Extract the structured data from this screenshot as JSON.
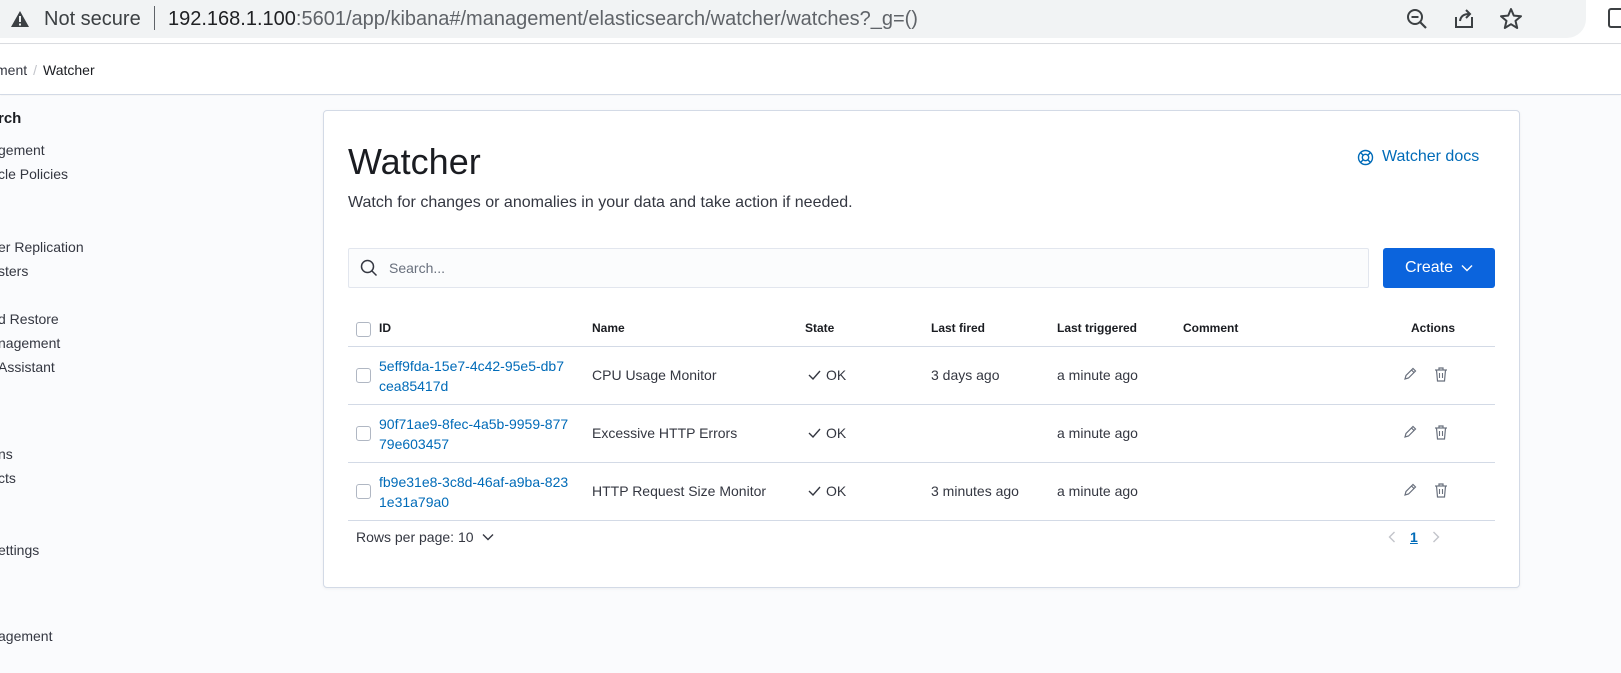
{
  "browser": {
    "security_label": "Not secure",
    "url_host": "192.168.1.100",
    "url_rest": ":5601/app/kibana#/management/elasticsearch/watcher/watches?_g=()"
  },
  "breadcrumb": {
    "parent": "ment",
    "current": "Watcher"
  },
  "sidebar": {
    "section_title": "rch",
    "items": [
      "gement",
      "cle Policies",
      "er Replication",
      "sters",
      "d Restore",
      "nagement",
      " Assistant",
      "ns",
      "cts",
      "ettings",
      "agement"
    ]
  },
  "header": {
    "title": "Watcher",
    "subtitle": "Watch for changes or anomalies in your data and take action if needed.",
    "docs_link": "Watcher docs"
  },
  "search": {
    "placeholder": "Search..."
  },
  "create_button": "Create",
  "table": {
    "columns": {
      "id": "ID",
      "name": "Name",
      "state": "State",
      "last_fired": "Last fired",
      "last_triggered": "Last triggered",
      "comment": "Comment",
      "actions": "Actions"
    },
    "rows": [
      {
        "id": "5eff9fda-15e7-4c42-95e5-db7cea85417d",
        "name": "CPU Usage Monitor",
        "state": "OK",
        "last_fired": "3 days ago",
        "last_triggered": "a minute ago",
        "comment": ""
      },
      {
        "id": "90f71ae9-8fec-4a5b-9959-87779e603457",
        "name": "Excessive HTTP Errors",
        "state": "OK",
        "last_fired": "",
        "last_triggered": "a minute ago",
        "comment": ""
      },
      {
        "id": "fb9e31e8-3c8d-46af-a9ba-8231e31a79a0",
        "name": "HTTP Request Size Monitor",
        "state": "OK",
        "last_fired": "3 minutes ago",
        "last_triggered": "a minute ago",
        "comment": ""
      }
    ]
  },
  "pagination": {
    "rows_per_page": "Rows per page: 10",
    "current_page": "1"
  },
  "colors": {
    "accent": "#0b64dd",
    "link": "#006bb8",
    "ok": "#017d73"
  }
}
